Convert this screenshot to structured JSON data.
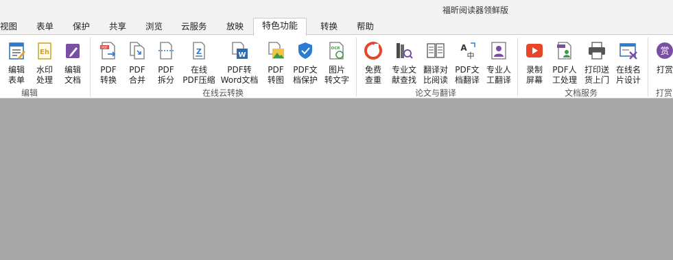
{
  "app": {
    "title": "福昕阅读器领鲜版"
  },
  "tabs": [
    {
      "label": "视图"
    },
    {
      "label": "表单"
    },
    {
      "label": "保护"
    },
    {
      "label": "共享"
    },
    {
      "label": "浏览"
    },
    {
      "label": "云服务"
    },
    {
      "label": "放映"
    },
    {
      "label": "特色功能"
    },
    {
      "label": "转换"
    },
    {
      "label": "帮助"
    }
  ],
  "ribbon": {
    "groups": [
      {
        "label": "编辑",
        "buttons": [
          {
            "label": "编辑\n表单",
            "icon": "edit-form-icon"
          },
          {
            "label": "水印\n处理",
            "icon": "watermark-icon"
          },
          {
            "label": "编辑\n文档",
            "icon": "edit-document-icon"
          }
        ]
      },
      {
        "label": "在线云转换",
        "buttons": [
          {
            "label": "PDF\n转换",
            "icon": "pdf-convert-icon"
          },
          {
            "label": "PDF\n合并",
            "icon": "pdf-merge-icon"
          },
          {
            "label": "PDF\n拆分",
            "icon": "pdf-split-icon"
          },
          {
            "label": "在线\nPDF压缩",
            "icon": "pdf-compress-icon"
          },
          {
            "label": "PDF转\nWord文档",
            "icon": "pdf-to-word-icon"
          },
          {
            "label": "PDF\n转图",
            "icon": "pdf-to-image-icon"
          },
          {
            "label": "PDF文\n档保护",
            "icon": "shield-icon"
          },
          {
            "label": "图片\n转文字",
            "icon": "ocr-icon"
          }
        ]
      },
      {
        "label": "论文与翻译",
        "buttons": [
          {
            "label": "免费\n查重",
            "icon": "plagiarism-check-icon"
          },
          {
            "label": "专业文\n献查找",
            "icon": "literature-search-icon"
          },
          {
            "label": "翻译对\n比阅读",
            "icon": "compare-translate-icon"
          },
          {
            "label": "PDF文\n档翻译",
            "icon": "translate-icon"
          },
          {
            "label": "专业人\n工翻译",
            "icon": "human-translate-icon"
          }
        ]
      },
      {
        "label": "文档服务",
        "buttons": [
          {
            "label": "录制\n屏幕",
            "icon": "screen-record-icon"
          },
          {
            "label": "PDF人\n工处理",
            "icon": "manual-processing-icon"
          },
          {
            "label": "打印送\n货上门",
            "icon": "printer-icon"
          },
          {
            "label": "在线名\n片设计",
            "icon": "business-card-icon"
          }
        ]
      },
      {
        "label": "打赏",
        "buttons": [
          {
            "label": "打赏",
            "icon": "reward-icon",
            "glyph": "赏"
          }
        ]
      }
    ]
  },
  "colors": {
    "ribbon_bg": "#ffffff",
    "tabbar_bg": "#f3f3f3",
    "document_bg": "#a8a8a8",
    "brand_red": "#e8462a",
    "brand_blue": "#2b7bd4",
    "brand_purple": "#7a4fa3"
  }
}
